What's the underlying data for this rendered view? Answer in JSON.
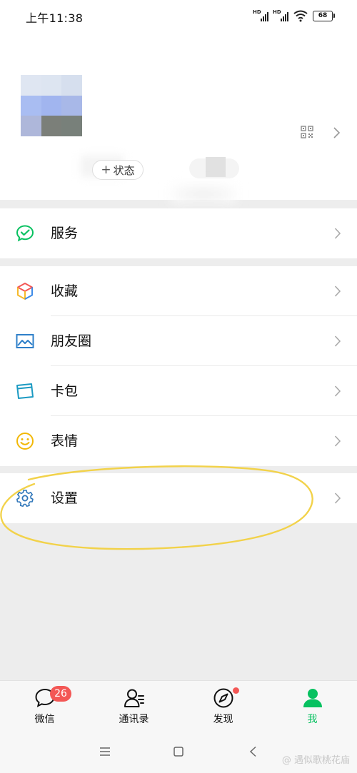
{
  "status_bar": {
    "time": "上午11:38",
    "sim1_tag": "HD",
    "sim2_tag": "HD",
    "battery": "68"
  },
  "profile": {
    "status_button": "状态",
    "status_plus": "+"
  },
  "menu": {
    "services": {
      "label": "服务",
      "icon": "wechat-pay-icon"
    },
    "favorites": {
      "label": "收藏",
      "icon": "cube-icon"
    },
    "moments": {
      "label": "朋友圈",
      "icon": "image-icon"
    },
    "cards": {
      "label": "卡包",
      "icon": "card-icon"
    },
    "stickers": {
      "label": "表情",
      "icon": "smile-icon"
    },
    "settings": {
      "label": "设置",
      "icon": "gear-icon"
    }
  },
  "tab_bar": {
    "chats": {
      "label": "微信",
      "badge": "26"
    },
    "contacts": {
      "label": "通讯录"
    },
    "discover": {
      "label": "发现"
    },
    "me": {
      "label": "我"
    }
  },
  "watermark": "@ 遇似歌桃花庙",
  "colors": {
    "accent_green": "#07c160",
    "badge_red": "#f35755",
    "highlight_yellow": "#f2d24a"
  }
}
